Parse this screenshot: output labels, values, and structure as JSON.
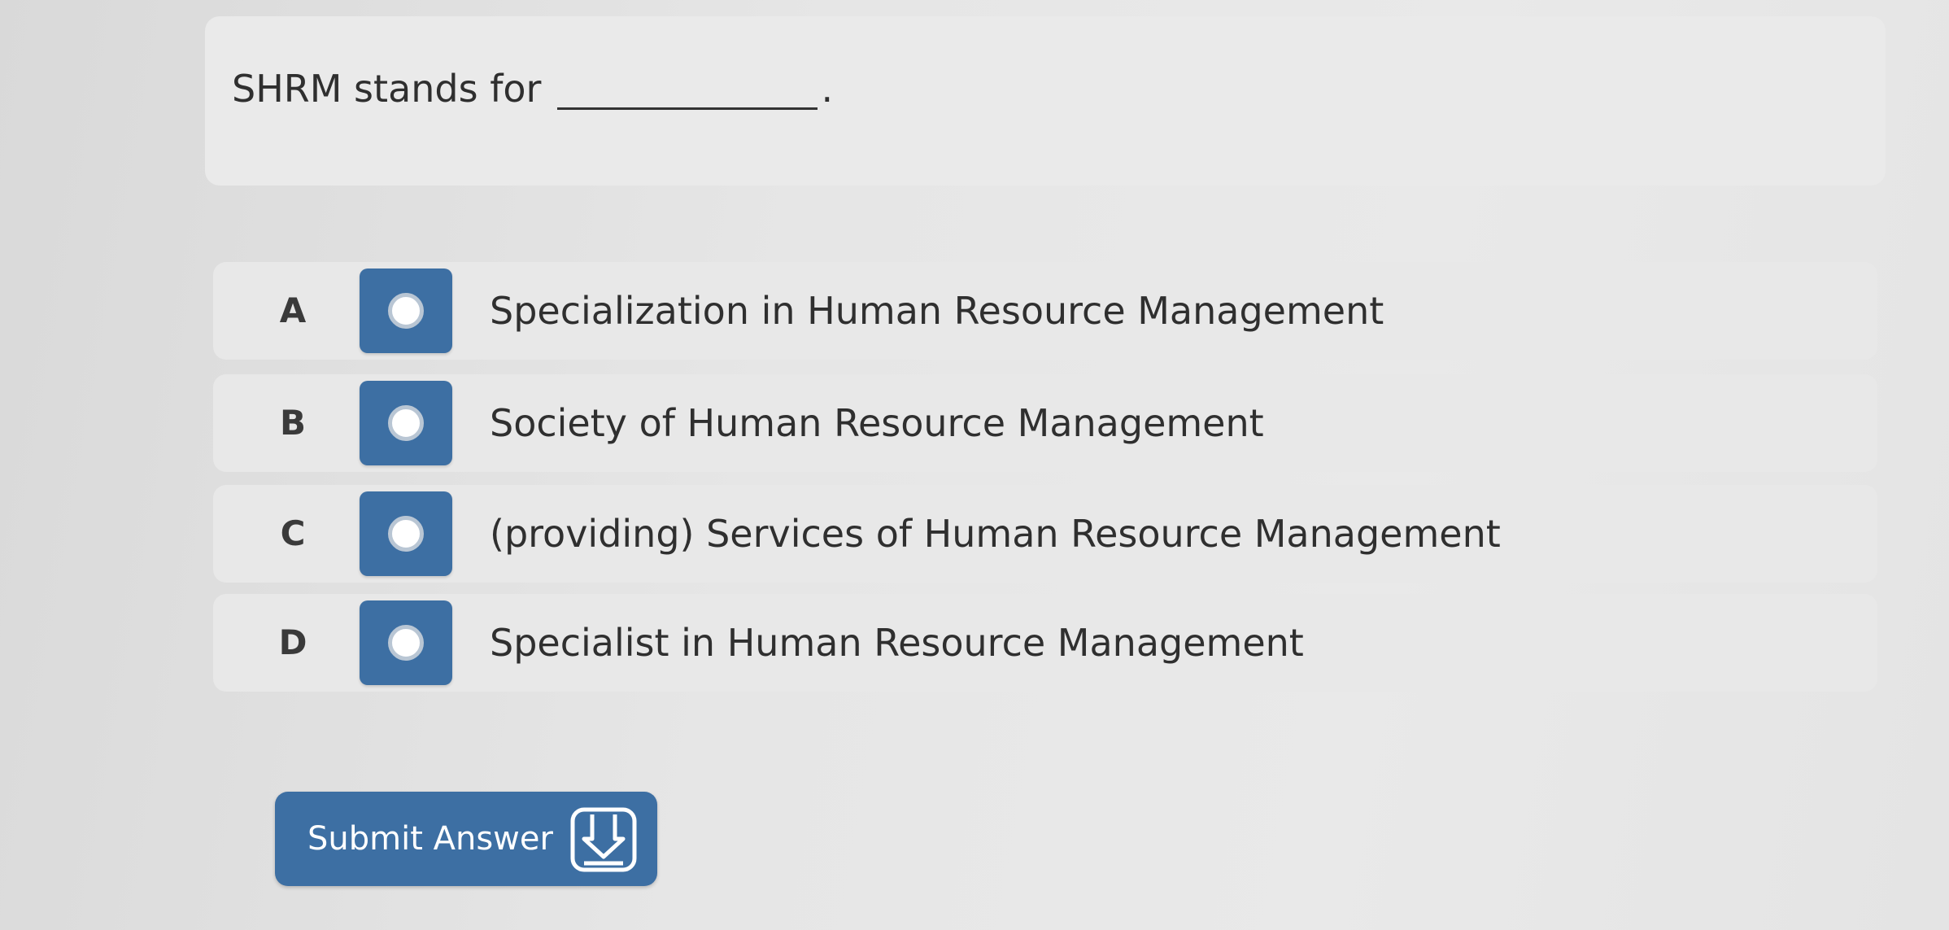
{
  "question": {
    "text": "SHRM stands for",
    "period": "."
  },
  "options": [
    {
      "letter": "A",
      "text": "Specialization in Human Resource Management"
    },
    {
      "letter": "B",
      "text": "Society of Human Resource Management"
    },
    {
      "letter": "C",
      "text": "(providing) Services of Human Resource Management"
    },
    {
      "letter": "D",
      "text": "Specialist in Human Resource Management"
    }
  ],
  "submit": {
    "label": "Submit Answer",
    "icon": "submit-tray-icon"
  },
  "colors": {
    "accent": "#3d6fa3",
    "background": "#e6e6e6"
  }
}
